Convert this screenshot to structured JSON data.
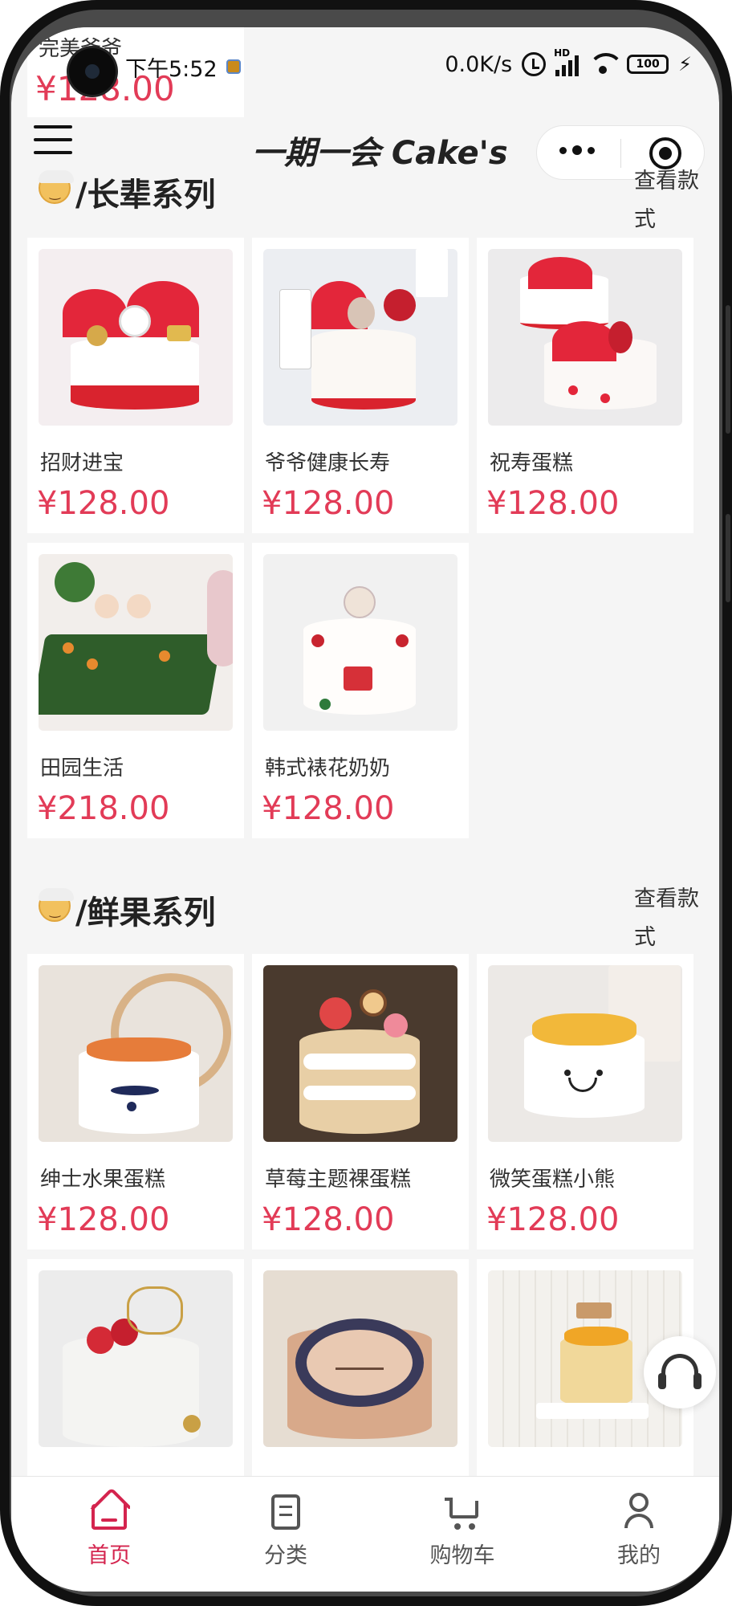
{
  "overlay": {
    "name": "完美爷爷",
    "price": "¥128.00"
  },
  "status_bar": {
    "time": "下午5:52",
    "speed": "0.0K/s",
    "signal_label": "HD",
    "battery": "100"
  },
  "nav": {
    "title": "一期一会 Cake's"
  },
  "sections": [
    {
      "title": "/长辈系列",
      "more": "查看款式",
      "products": [
        {
          "name": "招财进宝",
          "price": "¥128.00"
        },
        {
          "name": "爷爷健康长寿",
          "price": "¥128.00"
        },
        {
          "name": "祝寿蛋糕",
          "price": "¥128.00"
        },
        {
          "name": "田园生活",
          "price": "¥218.00"
        },
        {
          "name": "韩式裱花奶奶",
          "price": "¥128.00"
        }
      ]
    },
    {
      "title": "/鲜果系列",
      "more": "查看款式",
      "products": [
        {
          "name": "绅士水果蛋糕",
          "price": "¥128.00"
        },
        {
          "name": "草莓主题裸蛋糕",
          "price": "¥128.00"
        },
        {
          "name": "微笑蛋糕小熊",
          "price": "¥128.00"
        },
        {
          "name": "",
          "price": ""
        },
        {
          "name": "",
          "price": ""
        },
        {
          "name": "",
          "price": ""
        }
      ]
    }
  ],
  "tabs": [
    {
      "label": "首页",
      "icon": "home-icon",
      "active": true
    },
    {
      "label": "分类",
      "icon": "category-icon",
      "active": false
    },
    {
      "label": "购物车",
      "icon": "cart-icon",
      "active": false
    },
    {
      "label": "我的",
      "icon": "profile-icon",
      "active": false
    }
  ],
  "colors": {
    "accent": "#d4244e",
    "price": "#e23b57",
    "background": "#f5f5f5"
  }
}
